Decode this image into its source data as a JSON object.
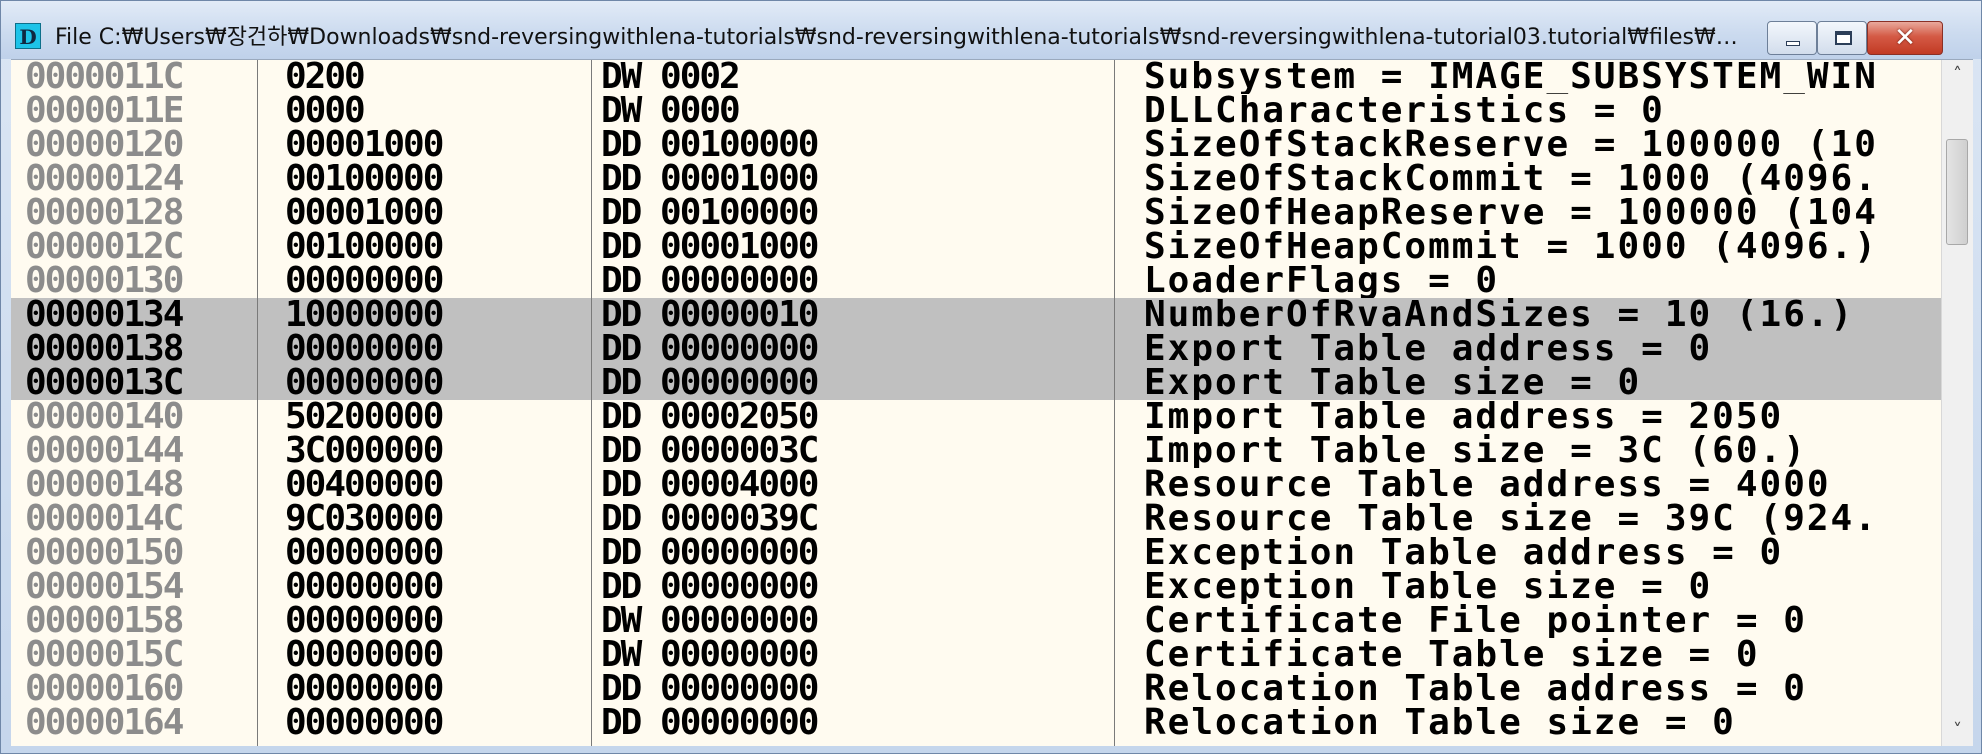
{
  "window": {
    "title": "File C:₩Users₩장건하₩Downloads₩snd-reversingwithlena-tutorials₩snd-reversingwithlena-tutorials₩snd-reversingwithlena-tutorial03.tutorial₩files₩Register...",
    "icon_letter": "D",
    "icon": "ollydbg-app-icon",
    "controls": {
      "minimize_icon": "minimize-icon",
      "maximize_icon": "maximize-icon",
      "close_icon": "close-icon",
      "close_glyph": "✕"
    }
  },
  "colors": {
    "selection": "#c0c0c0",
    "background": "#fffbf0",
    "address_gray": "#8c8c8c",
    "close_red": "#c23a24"
  },
  "dump": {
    "rows": [
      {
        "address": "0000011C",
        "hex": "0200",
        "disasm": "DW 0002",
        "comment": "Subsystem = IMAGE_SUBSYSTEM_WIN",
        "selected": false
      },
      {
        "address": "0000011E",
        "hex": "0000",
        "disasm": "DW 0000",
        "comment": "DLLCharacteristics = 0",
        "selected": false
      },
      {
        "address": "00000120",
        "hex": "00001000",
        "disasm": "DD 00100000",
        "comment": "SizeOfStackReserve = 100000 (10",
        "selected": false
      },
      {
        "address": "00000124",
        "hex": "00100000",
        "disasm": "DD 00001000",
        "comment": "SizeOfStackCommit = 1000 (4096.",
        "selected": false
      },
      {
        "address": "00000128",
        "hex": "00001000",
        "disasm": "DD 00100000",
        "comment": "SizeOfHeapReserve = 100000 (104",
        "selected": false
      },
      {
        "address": "0000012C",
        "hex": "00100000",
        "disasm": "DD 00001000",
        "comment": "SizeOfHeapCommit = 1000 (4096.)",
        "selected": false
      },
      {
        "address": "00000130",
        "hex": "00000000",
        "disasm": "DD 00000000",
        "comment": "LoaderFlags = 0",
        "selected": false
      },
      {
        "address": "00000134",
        "hex": "10000000",
        "disasm": "DD 00000010",
        "comment": "NumberOfRvaAndSizes = 10 (16.)",
        "selected": true
      },
      {
        "address": "00000138",
        "hex": "00000000",
        "disasm": "DD 00000000",
        "comment": "Export Table address = 0",
        "selected": true
      },
      {
        "address": "0000013C",
        "hex": "00000000",
        "disasm": "DD 00000000",
        "comment": "Export Table size = 0",
        "selected": true
      },
      {
        "address": "00000140",
        "hex": "50200000",
        "disasm": "DD 00002050",
        "comment": "Import Table address = 2050",
        "selected": false
      },
      {
        "address": "00000144",
        "hex": "3C000000",
        "disasm": "DD 0000003C",
        "comment": "Import Table size = 3C (60.)",
        "selected": false
      },
      {
        "address": "00000148",
        "hex": "00400000",
        "disasm": "DD 00004000",
        "comment": "Resource Table address = 4000",
        "selected": false
      },
      {
        "address": "0000014C",
        "hex": "9C030000",
        "disasm": "DD 0000039C",
        "comment": "Resource Table size = 39C (924.",
        "selected": false
      },
      {
        "address": "00000150",
        "hex": "00000000",
        "disasm": "DD 00000000",
        "comment": "Exception Table address = 0",
        "selected": false
      },
      {
        "address": "00000154",
        "hex": "00000000",
        "disasm": "DD 00000000",
        "comment": "Exception Table size = 0",
        "selected": false
      },
      {
        "address": "00000158",
        "hex": "00000000",
        "disasm": "DW 00000000",
        "comment": "Certificate File pointer = 0",
        "selected": false
      },
      {
        "address": "0000015C",
        "hex": "00000000",
        "disasm": "DW 00000000",
        "comment": "Certificate Table size = 0",
        "selected": false
      },
      {
        "address": "00000160",
        "hex": "00000000",
        "disasm": "DD 00000000",
        "comment": "Relocation Table address = 0",
        "selected": false
      },
      {
        "address": "00000164",
        "hex": "00000000",
        "disasm": "DD 00000000",
        "comment": "Relocation Table size = 0",
        "selected": false
      }
    ]
  },
  "scrollbar": {
    "up_glyph": "˄",
    "down_glyph": "˅",
    "up_icon": "scroll-up-arrow-icon",
    "down_icon": "scroll-down-arrow-icon",
    "position": 0.1
  }
}
